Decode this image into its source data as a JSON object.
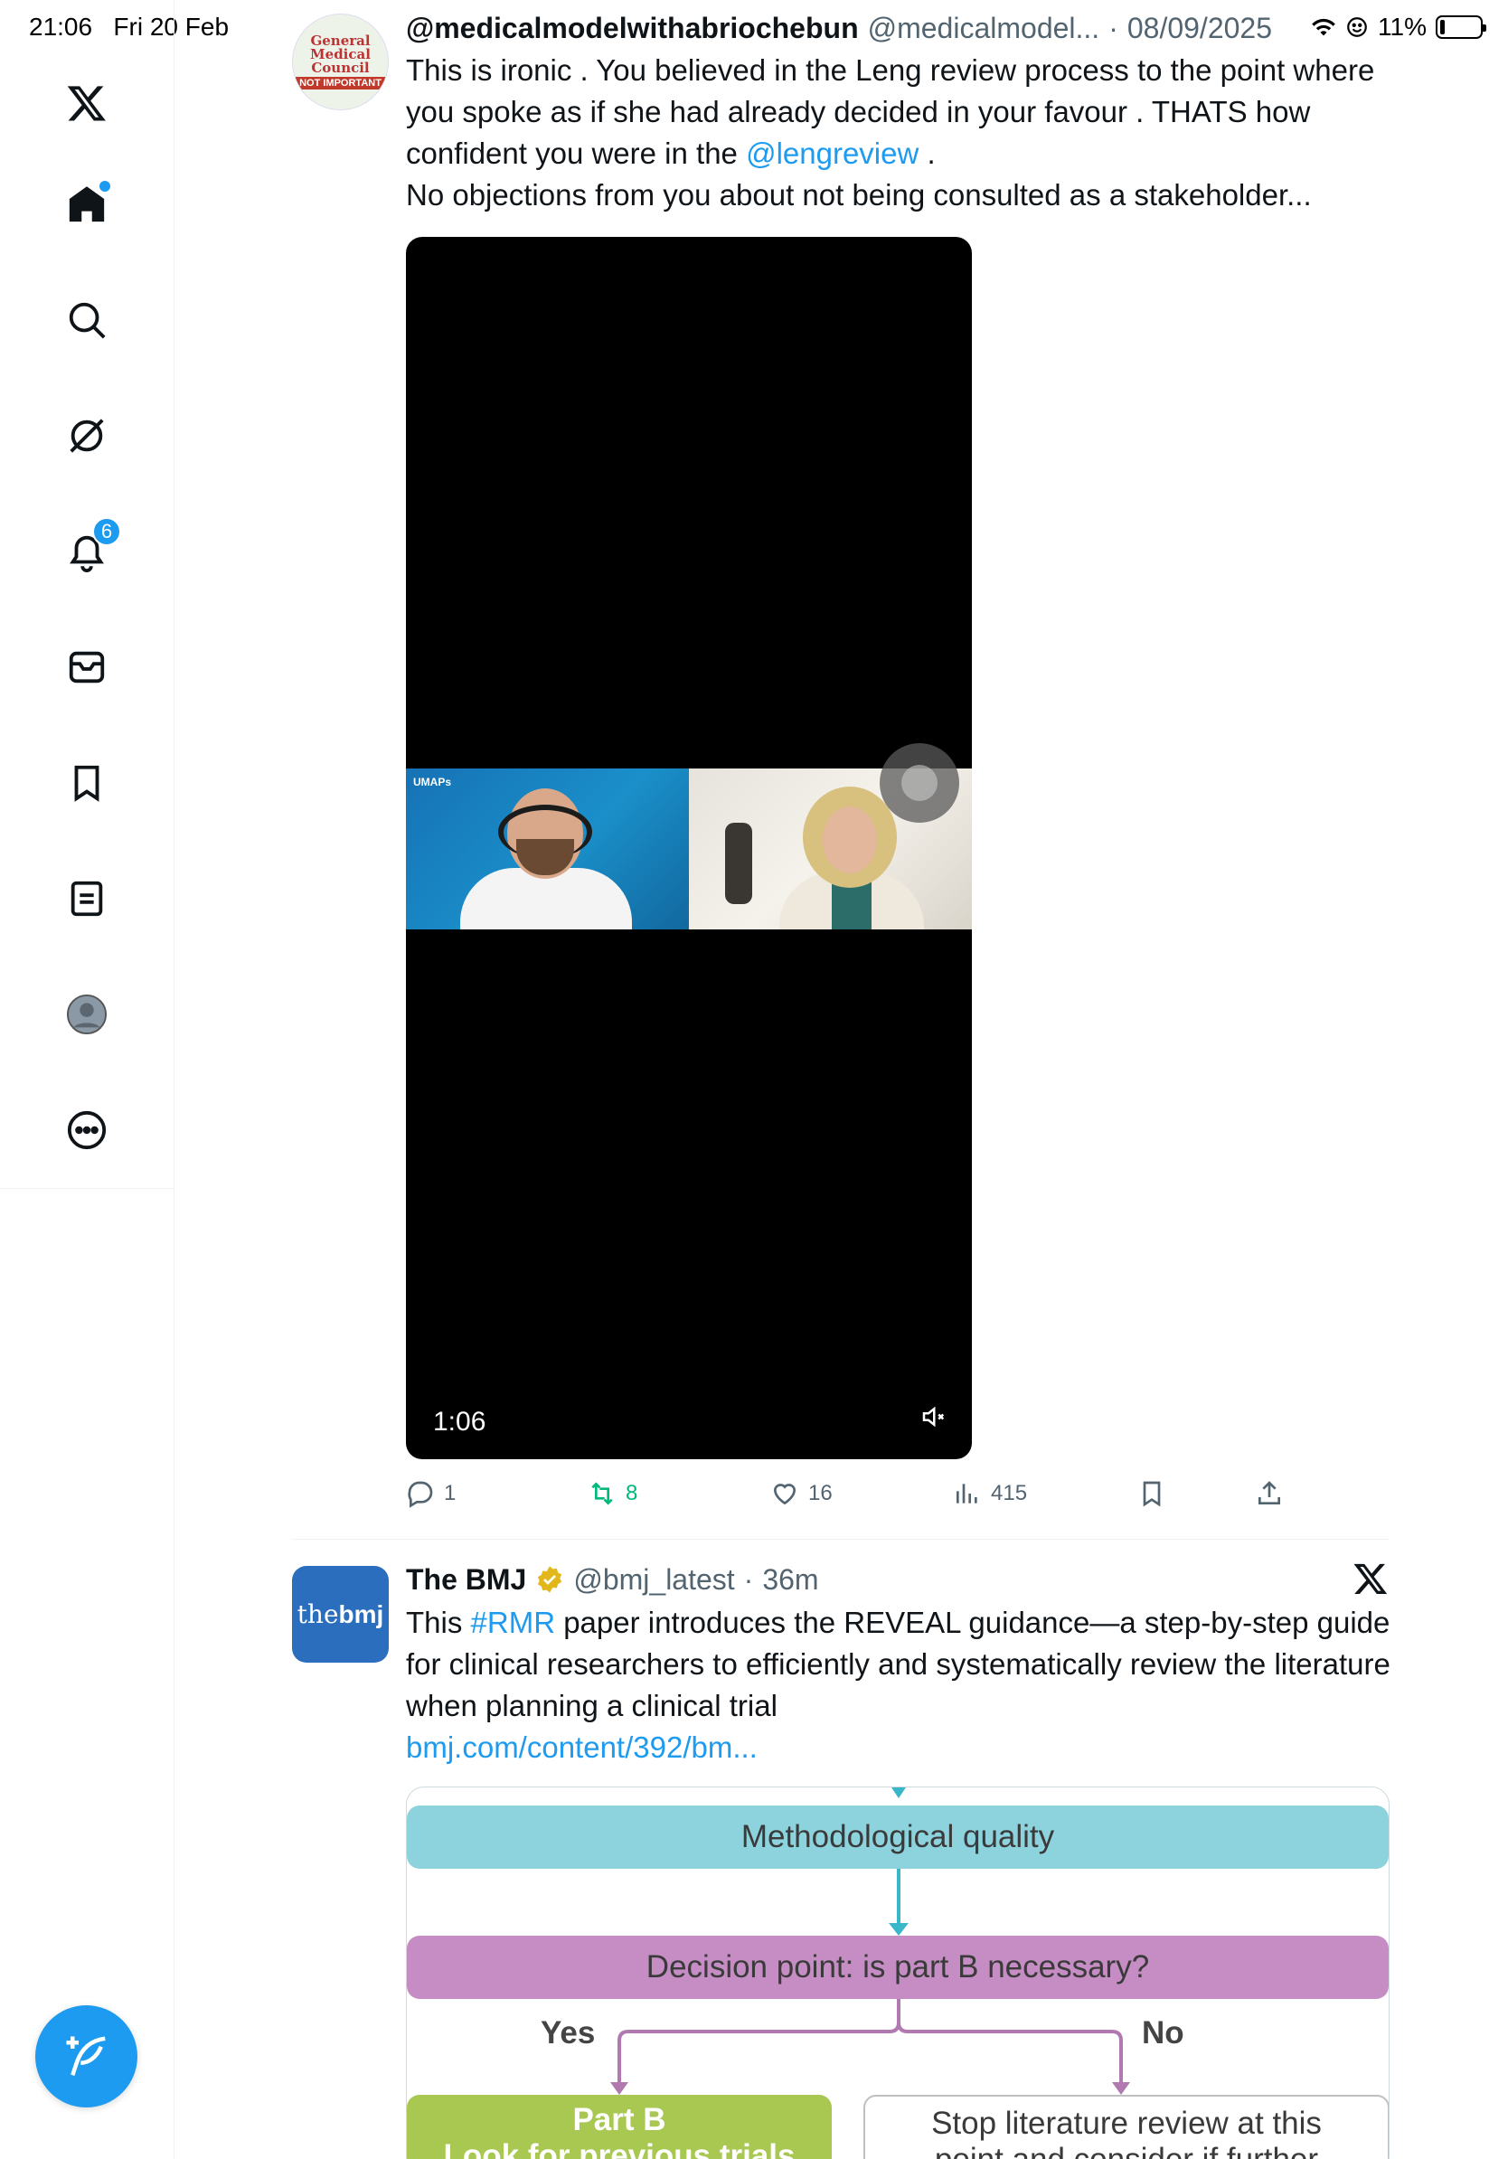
{
  "status_bar": {
    "time": "21:06",
    "date": "Fri 20 Feb",
    "battery": "11%",
    "battery_level": 0.11
  },
  "sidebar": {
    "items": [
      {
        "name": "x-logo"
      },
      {
        "name": "home"
      },
      {
        "name": "search"
      },
      {
        "name": "grok"
      },
      {
        "name": "notifications",
        "badge": "6"
      },
      {
        "name": "messages"
      },
      {
        "name": "bookmarks"
      },
      {
        "name": "lists"
      },
      {
        "name": "profile"
      },
      {
        "name": "more"
      }
    ]
  },
  "tweet1": {
    "display_name": "@medicalmodelwithabriochebun",
    "handle": "@medicalmodel...",
    "sep": "·",
    "date": "08/09/2025",
    "avatar_lines": [
      "General",
      "Medical",
      "Council"
    ],
    "avatar_box": "NOT IMPORTANT",
    "text_part1": "This is ironic . You believed in the Leng review process to the point where you spoke as if she had already decided in your favour . THATS how confident you were in the ",
    "mention": "@lengreview",
    "text_part2": " .",
    "text_line2": "No objections from you about not being consulted as a stakeholder...",
    "video_duration": "1:06",
    "video_watermark": "UMAPs",
    "actions": {
      "replies": "1",
      "reposts": "8",
      "likes": "16",
      "views": "415"
    }
  },
  "tweet2": {
    "display_name": "The BMJ",
    "handle": "@bmj_latest",
    "sep": "·",
    "time": "36m",
    "avatar_the": "the",
    "avatar_bmj": "bmj",
    "text_part1": "This ",
    "hashtag": "#RMR",
    "text_part2": " paper introduces the REVEAL guidance—a step-by-step guide for clinical researchers to efficiently and systematically review the literature when planning a clinical trial",
    "url": "bmj.com/content/392/bm...",
    "flowchart": {
      "box1": "Methodological quality",
      "box2": "Decision point: is part B necessary?",
      "yes": "Yes",
      "no": "No",
      "box3_title": "Part B",
      "box3_sub": "Look for previous trials",
      "box4_line1": "Stop literature review at this",
      "box4_line2": "point and consider if further"
    }
  },
  "colors": {
    "accent": "#1d9bf0",
    "repost_green": "#00ba7c",
    "teal_box": "#8dd3de",
    "purple_box": "#c58dc3",
    "green_box": "#a8c852"
  }
}
